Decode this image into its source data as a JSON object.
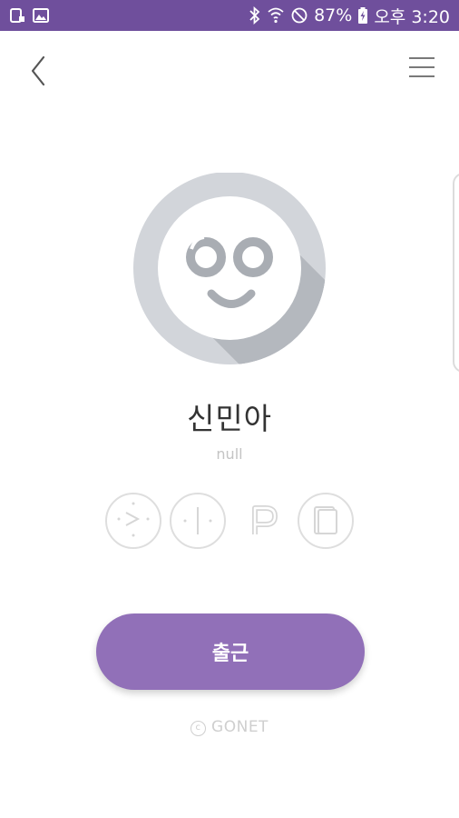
{
  "status_bar": {
    "battery": "87%",
    "time": "오후 3:20",
    "left_icons": [
      "tablet-notification-icon",
      "image-notification-icon"
    ],
    "right_icons": [
      "bluetooth-icon",
      "wifi-icon",
      "do-not-disturb-icon",
      "battery-charging-icon"
    ]
  },
  "header": {
    "back_icon": "chevron-left-icon",
    "menu_icon": "hamburger-menu-icon"
  },
  "profile": {
    "avatar_icon": "smiley-face-logo-icon",
    "name": "신민아",
    "subtitle": "null"
  },
  "quick_icons": [
    "commute-route-icon",
    "road-lane-icon",
    "parking-icon",
    "notebook-icon"
  ],
  "primary_action": {
    "label": "출근"
  },
  "footer": {
    "copyright_mark": "c",
    "brand": "GONET"
  },
  "colors": {
    "status_bar": "#6f4f9c",
    "primary_button": "#9170b8",
    "avatar_ring": "#d2d5da",
    "avatar_shadow": "#b4b8be",
    "avatar_face": "#a9adb3",
    "muted_text": "#c4c4c4"
  }
}
